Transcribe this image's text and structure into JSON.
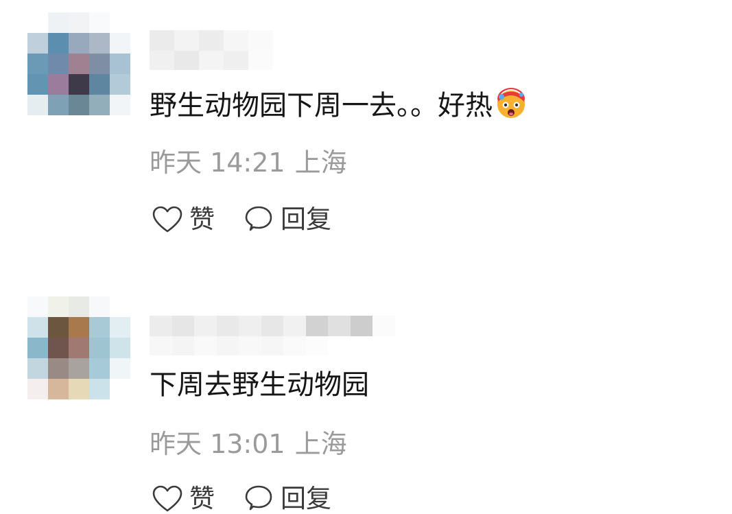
{
  "comments": [
    {
      "text": "野生动物园下周一去。。好热",
      "emoji_icon": "hot-face-emoji-icon",
      "time": "昨天 14:21",
      "location": "上海",
      "like_label": "赞",
      "reply_label": "回复",
      "avatar_colors": [
        "#ffffff",
        "#eef2f5",
        "#f1f3f5",
        "#f9fafb",
        "#ffffff",
        "#bfcfdb",
        "#5c8eb0",
        "#98a8bd",
        "#adb8c6",
        "#f2f5f8",
        "#6b9ab7",
        "#6f8aaa",
        "#a08191",
        "#7e8fa5",
        "#a9c2d3",
        "#6395b3",
        "#9b7c9c",
        "#3f3a4a",
        "#5e86a1",
        "#b3cbd8",
        "#e6edf1",
        "#7ea1b5",
        "#6a8795",
        "#93aebb",
        "#f1f5f7"
      ]
    },
    {
      "text": "下周去野生动物园",
      "time": "昨天 13:01",
      "location": "上海",
      "like_label": "赞",
      "reply_label": "回复",
      "avatar_colors": [
        "#f7f9fb",
        "#f0f1e8",
        "#e8eae6",
        "#f6f8fa",
        "#ffffff",
        "#cfe2ea",
        "#6d5640",
        "#a8794d",
        "#a8cad6",
        "#e3eef2",
        "#8bb7cb",
        "#70554e",
        "#a07a72",
        "#9ec4d2",
        "#cfe3ea",
        "#c1d6df",
        "#9a8a86",
        "#a9a3a0",
        "#a7cad8",
        "#f0f5f8",
        "#f4eeee",
        "#d7b79c",
        "#e6d9b8",
        "#cce2ea",
        "#ffffff"
      ]
    }
  ],
  "colors": {
    "text": "#151515",
    "meta": "#9a9a9a",
    "action": "#3a3a3a"
  }
}
